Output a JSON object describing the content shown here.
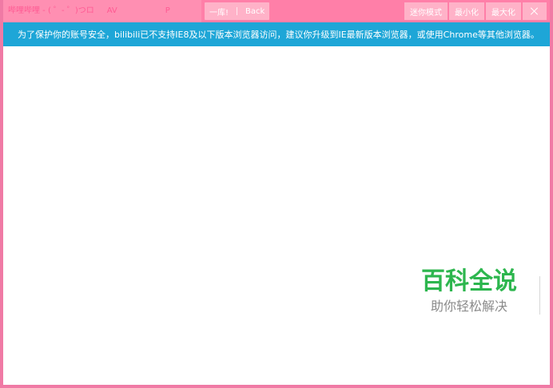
{
  "window": {
    "title": "哔哩哔哩 - ( ゜- ゜)つロ AV P",
    "title_parts": [
      "哔哩哔哩 - ( ゜- ゜)つロ",
      "AV",
      "P"
    ],
    "segment": {
      "left_label": "一库!",
      "back_label": "Back"
    },
    "controls": {
      "mini_mode": "迷你模式",
      "minimize": "最小化",
      "maximize": "最大化"
    }
  },
  "notice": {
    "text": "为了保护你的账号安全，bilibili已不支持IE8及以下版本浏览器访问，建议你升级到IE最新版本浏览器，或使用Chrome等其他浏览器。"
  },
  "watermark": {
    "title": "百科全说",
    "subtitle": "助你轻松解决"
  },
  "colors": {
    "titlebar": "#ff7fa8",
    "title_button": "#ffb2c8",
    "notice": "#1ea6d7",
    "border": "#f07aa5",
    "watermark_green": "#2db64e"
  }
}
